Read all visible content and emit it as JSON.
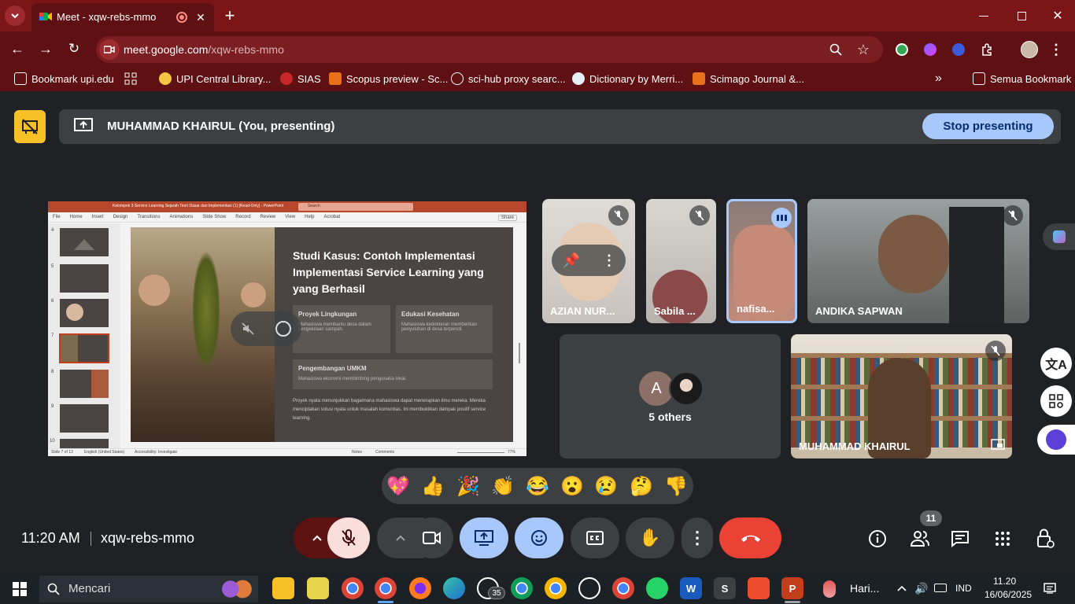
{
  "browser": {
    "tab_title": "Meet - xqw-rebs-mmo",
    "url_host": "meet.google.com",
    "url_path": "/xqw-rebs-mmo",
    "bookmarks": [
      "Bookmark upi.edu",
      "UPI Central Library...",
      "SIAS",
      "Scopus preview - Sc...",
      "sci-hub proxy searc...",
      "Dictionary by Merri...",
      "Scimago Journal &...",
      "Semua Bookmark"
    ]
  },
  "presenting_banner": {
    "text": "MUHAMMAD KHAIRUL (You, presenting)",
    "stop_label": "Stop presenting"
  },
  "slide": {
    "window_title": "Kelompok 3 Service Learning Sejarah Teori Dasar dan Implementasi (1) [Read-Only] - PowerPoint",
    "search_placeholder": "Search",
    "menu": [
      "File",
      "Home",
      "Insert",
      "Design",
      "Transitions",
      "Animations",
      "Slide Show",
      "Record",
      "Review",
      "View",
      "Help",
      "Acrobat"
    ],
    "share_label": "Share",
    "thumb_numbers": [
      "4",
      "5",
      "6",
      "7",
      "8",
      "9",
      "10"
    ],
    "title": "Studi Kasus: Contoh Implementasi Implementasi Service Learning yang yang Berhasil",
    "card1_title": "Proyek Lingkungan",
    "card1_text": "Mahasiswa membantu desa dalam pengelolaan sampah.",
    "card2_title": "Edukasi Kesehatan",
    "card2_text": "Mahasiswa kedokteran memberikan penyuluhan di desa terpencil.",
    "card3_title": "Pengembangan UMKM",
    "card3_text": "Mahasiswa ekonomi membimbing pengusaha lokal.",
    "body_text": "Proyek nyata menunjukkan bagaimana mahasiswa dapat menerapkan ilmu mereka. Mereka menciptakan solusi nyata untuk masalah komunitas. Ini membuktikan dampak positif service learning.",
    "status_left": "Slide 7 of 13",
    "status_lang": "English (United States)",
    "status_access": "Accessibility: Investigate",
    "status_notes": "Notes",
    "status_comments": "Comments",
    "zoom": "77%"
  },
  "participants": [
    {
      "name": "AZIAN NUR...",
      "muted": true
    },
    {
      "name": "Sabila ...",
      "muted": true
    },
    {
      "name": "nafisa...",
      "muted": false
    },
    {
      "name": "ANDIKA SAPWAN",
      "muted": true
    },
    {
      "name": "MUHAMMAD KHAIRUL",
      "muted": true
    }
  ],
  "others": {
    "avatar_letter": "A",
    "label": "5 others"
  },
  "reactions": [
    "💖",
    "👍",
    "🎉",
    "👏",
    "😂",
    "😮",
    "😢",
    "🤔",
    "👎"
  ],
  "bottom_bar": {
    "time": "11:20 AM",
    "meeting_code": "xqw-rebs-mmo",
    "people_count": "11"
  },
  "taskbar": {
    "search_placeholder": "Mencari",
    "badge_count": "35",
    "weather_label": "Hari...",
    "lang": "IND",
    "clock_time": "11.20",
    "clock_date": "16/06/2025"
  },
  "colors": {
    "chrome_tab_strip": "#7a1518",
    "chrome_toolbar": "#5e1013",
    "meet_bg": "#202124",
    "stop_button": "#a8c7fa",
    "end_call": "#ea4335",
    "mic_off_bg": "#f9dedc"
  }
}
